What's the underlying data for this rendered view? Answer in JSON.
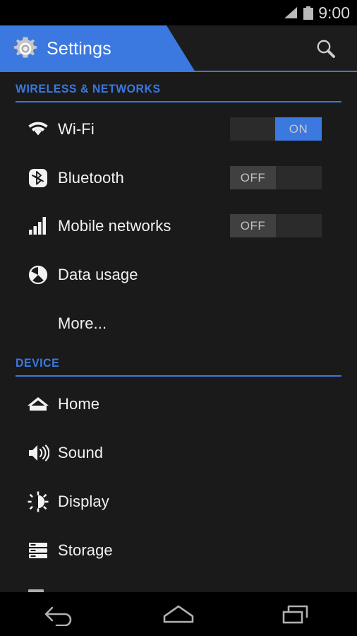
{
  "status_bar": {
    "clock": "9:00",
    "signal_icon": "signal-bars-icon",
    "battery_icon": "battery-full-icon"
  },
  "action_bar": {
    "title": "Settings",
    "app_icon": "settings-gear-icon",
    "search_icon": "search-icon",
    "accent_color": "#3b78e0"
  },
  "sections": [
    {
      "header": "WIRELESS & NETWORKS",
      "rows": [
        {
          "label": "Wi-Fi",
          "icon": "wifi-icon",
          "toggle": "ON"
        },
        {
          "label": "Bluetooth",
          "icon": "bluetooth-icon",
          "toggle": "OFF"
        },
        {
          "label": "Mobile networks",
          "icon": "signal-bars-icon",
          "toggle": "OFF"
        },
        {
          "label": "Data usage",
          "icon": "data-usage-pie-icon",
          "toggle": null
        },
        {
          "label": "More...",
          "icon": null,
          "toggle": null
        }
      ]
    },
    {
      "header": "DEVICE",
      "rows": [
        {
          "label": "Home",
          "icon": "home-house-icon",
          "toggle": null
        },
        {
          "label": "Sound",
          "icon": "sound-speaker-icon",
          "toggle": null
        },
        {
          "label": "Display",
          "icon": "display-sun-icon",
          "toggle": null
        },
        {
          "label": "Storage",
          "icon": "storage-disks-icon",
          "toggle": null
        }
      ]
    }
  ],
  "nav_bar": {
    "back_label": "Back",
    "home_label": "Home",
    "recents_label": "Recent apps"
  },
  "colors": {
    "background": "#1a1a1a",
    "accent": "#3b78e0",
    "text_primary": "#f2f2f2",
    "toggle_off_thumb": "#404040",
    "toggle_track": "#2b2b2b"
  }
}
